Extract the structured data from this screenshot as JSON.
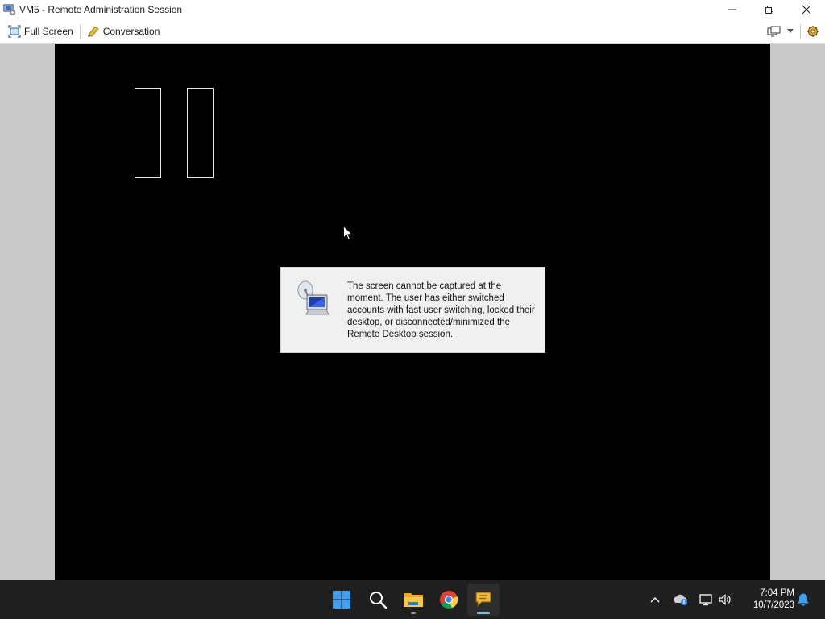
{
  "window": {
    "title": "VM5 - Remote Administration Session",
    "controls": {
      "minimize": "—",
      "restore": "❐",
      "close": "✕"
    }
  },
  "toolbar": {
    "full_screen_label": "Full Screen",
    "conversation_label": "Conversation",
    "right_icons": [
      "monitor-icon",
      "dropdown-arrow-icon",
      "settings-icon"
    ]
  },
  "remote": {
    "message": "The screen cannot be captured at the moment. The user has either switched accounts with fast user switching, locked their desktop, or disconnected/minimized the Remote Desktop session.",
    "message_icon": "computer-with-satellite-icon"
  },
  "taskbar": {
    "apps": [
      "windows-start-icon",
      "search-icon",
      "file-explorer-icon",
      "chrome-icon",
      "conversation-app-icon"
    ],
    "tray": [
      "chevron-up-icon",
      "onedrive-icon",
      "network-icon",
      "speaker-icon",
      "notification-bell-icon"
    ],
    "time": "7:04 PM",
    "date": "10/7/2023"
  },
  "colors": {
    "remote_screen": "#000000",
    "letterbox": "#c9c9c9",
    "taskbar": "#1f1f1f",
    "active_indicator": "#60cdff"
  }
}
